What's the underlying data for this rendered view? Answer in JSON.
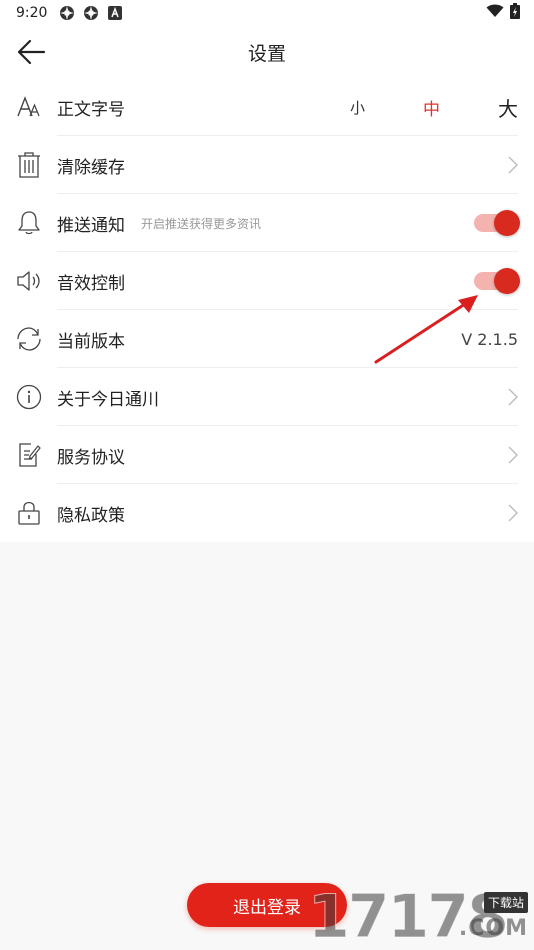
{
  "status_bar": {
    "time": "9:20",
    "left_icons": [
      "gear-icon",
      "gear-icon",
      "a-letter-icon"
    ],
    "right_icons": [
      "wifi-icon",
      "battery-charging-icon"
    ]
  },
  "header": {
    "title": "设置",
    "back_icon": "arrow-left-icon"
  },
  "settings": {
    "font_size": {
      "label": "正文字号",
      "icon": "font-size-icon",
      "options": [
        "小",
        "中",
        "大"
      ],
      "selected": "中"
    },
    "clear_cache": {
      "label": "清除缓存",
      "icon": "trash-icon"
    },
    "push": {
      "label": "推送通知",
      "hint": "开启推送获得更多资讯",
      "icon": "bell-icon",
      "enabled": true
    },
    "sound": {
      "label": "音效控制",
      "icon": "speaker-icon",
      "enabled": true
    },
    "version": {
      "label": "当前版本",
      "value": "V 2.1.5",
      "icon": "refresh-icon"
    },
    "about": {
      "label": "关于今日通川",
      "icon": "info-icon"
    },
    "terms": {
      "label": "服务协议",
      "icon": "document-icon"
    },
    "privacy": {
      "label": "隐私政策",
      "icon": "lock-icon"
    }
  },
  "logout": {
    "label": "退出登录"
  },
  "watermark": {
    "digits": "17178",
    "tag": "下载站",
    "suffix": ".COM"
  },
  "colors": {
    "accent": "#e2231a",
    "selected_text": "#e0322b",
    "toggle_track": "#f5b3b0",
    "toggle_knob": "#d92a20"
  }
}
